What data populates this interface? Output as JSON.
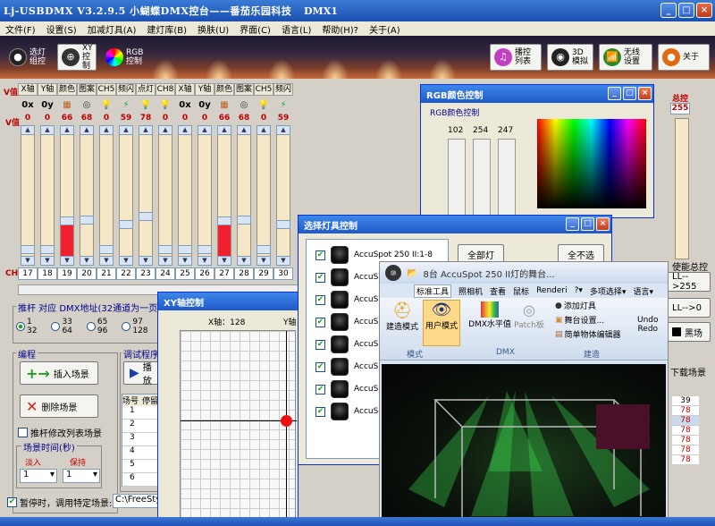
{
  "app": {
    "title": "Lj-USBDMX V3.2.9.5 小蝴蝶DMX控台——番茄乐园科技",
    "dmx_label": "DMX1",
    "window_buttons": [
      "_",
      "□",
      "×"
    ]
  },
  "menu": [
    "文件(F)",
    "设置(S)",
    "加减灯具(A)",
    "建灯库(B)",
    "换肤(U)",
    "界面(C)",
    "语言(L)",
    "帮助(H)?",
    "关于(A)"
  ],
  "toolbar": {
    "select_light": "选灯\n组控",
    "xy_control": "XY控制",
    "rgb_control": "RGB\n控制",
    "play_list": "播控\n列表",
    "3d_sim": "3D\n模拟",
    "wireless": "无线\n设置",
    "about": "关于"
  },
  "channels": {
    "headers": [
      "X轴",
      "Y轴",
      "颜色",
      "图案",
      "CH5",
      "频闪",
      "点灯",
      "CH8",
      "X轴",
      "Y轴",
      "颜色",
      "图案",
      "CH5",
      "频闪",
      "点灯",
      "CH8",
      "X轴",
      "Y轴",
      "颜色",
      "图案",
      "CH5",
      "频闪",
      "点灯",
      "CH8"
    ],
    "icons": [
      "0x",
      "0y",
      "color",
      "pattern",
      "bulb",
      "strobe",
      "dot",
      "bulb",
      "0x",
      "0y",
      "color",
      "pattern",
      "bulb",
      "strobe",
      "dot",
      "bulb",
      "0x",
      "0y",
      "color",
      "pattern",
      "bulb",
      "strobe",
      "dot",
      "bulb"
    ],
    "values": [
      "0",
      "0",
      "66",
      "68",
      "0",
      "59",
      "78",
      "0",
      "0",
      "0",
      "66",
      "68",
      "0",
      "59",
      "78",
      "0",
      "0",
      "0",
      "66",
      "68",
      "0",
      "59",
      "78",
      "0"
    ],
    "numbers": [
      "17",
      "18",
      "19",
      "20",
      "21",
      "22",
      "23",
      "24",
      "25",
      "26",
      "27",
      "28",
      "29",
      "30"
    ],
    "v_label": "V值",
    "ch_label": "CH"
  },
  "right_strip": {
    "header": "总控",
    "value": "255",
    "master_label": "使能总控",
    "btn_up": "LL-->255",
    "btn_down": "LL-->0",
    "blackout": "黑场",
    "download": "下载场景",
    "list": [
      "39",
      "78",
      "78",
      "78",
      "78",
      "78",
      "78"
    ]
  },
  "push": {
    "legend": "推杆 对应 DMX地址(32通道为一页)",
    "options": [
      "1\n32",
      "33\n64",
      "65\n96",
      "97\n128"
    ]
  },
  "program": {
    "legend": "编程",
    "insert": "插入场景",
    "delete": "删除场景",
    "modify_check": "推杆修改列表场景",
    "time_legend": "场景时间(秒)",
    "time_labels": [
      "淡入",
      "保持"
    ],
    "time_values": [
      "1",
      "1"
    ],
    "pause_label": "暂停时，调用特定场景:",
    "path": "C:\\FreeStyl"
  },
  "debug": {
    "legend": "调试程序",
    "play": "播放",
    "table_headers": [
      "场号",
      "停留"
    ],
    "table_rows": [
      "1",
      "2",
      "3",
      "4",
      "5",
      "6"
    ]
  },
  "rgb_win": {
    "title": "RGB颜色控制",
    "group": "RGB颜色控制",
    "values": [
      "102",
      "254",
      "247"
    ]
  },
  "select_win": {
    "title": "选择灯具控制",
    "all_btn": "全部灯",
    "none_btn": "全不选",
    "items": [
      "AccuSpot 250 II:1-8",
      "AccuS",
      "AccuS",
      "AccuS",
      "AccuS",
      "AccuS",
      "AccuS",
      "AccuS"
    ]
  },
  "xy_win": {
    "title": "XY轴控制",
    "x_label": "X轴：",
    "x_value": "128",
    "y_label": "Y轴"
  },
  "sim_win": {
    "title": "8台 AccuSpot 250 II灯的舞台...",
    "tabs": [
      "标准工具",
      "照相机",
      "查看",
      "鼠标",
      "Renderi",
      "?",
      "多项选择",
      "语言"
    ],
    "tab_arrows": [
      "▾",
      "▾",
      "▾"
    ],
    "mode_group": "模式",
    "build_mode": "建造模式",
    "user_mode": "用户模式",
    "dmx_group": "DMX",
    "dmx_level": "DMX水平值",
    "patch": "Patch板",
    "build_group": "建造",
    "add_light": "添加灯具",
    "stage_setup": "舞台设置...",
    "object_editor": "简单物体编辑器",
    "undo": "Undo\nRedo"
  },
  "colors": {
    "strip_fill": "#f5e8c8",
    "red_fill": "#f02030",
    "title_blue": "#1f5ac9",
    "value_red": "#c00000"
  }
}
